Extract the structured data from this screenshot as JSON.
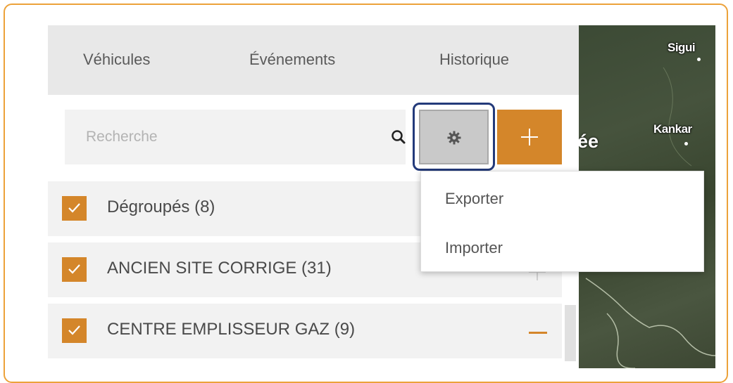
{
  "tabs": [
    {
      "label": "Véhicules"
    },
    {
      "label": "Événements"
    },
    {
      "label": "Historique"
    }
  ],
  "search": {
    "placeholder": "Recherche",
    "icon": "search-icon"
  },
  "toolbar": {
    "settings_icon": "gear-icon",
    "add_icon": "plus-icon"
  },
  "settings_menu": {
    "items": [
      {
        "label": "Exporter"
      },
      {
        "label": "Importer"
      }
    ]
  },
  "groups": [
    {
      "label": "Dégroupés (8)",
      "checked": true
    },
    {
      "label": "ANCIEN SITE CORRIGE (31)",
      "checked": true,
      "toggle": "expand"
    },
    {
      "label": "CENTRE EMPLISSEUR GAZ (9)",
      "checked": true,
      "toggle": "collapse"
    }
  ],
  "map": {
    "labels": [
      {
        "text": "Sigui"
      },
      {
        "text": "Kankar"
      },
      {
        "text": "ée"
      }
    ]
  },
  "colors": {
    "accent": "#d4862a",
    "highlight_border": "#233a7a",
    "frame": "#ECA23A"
  }
}
